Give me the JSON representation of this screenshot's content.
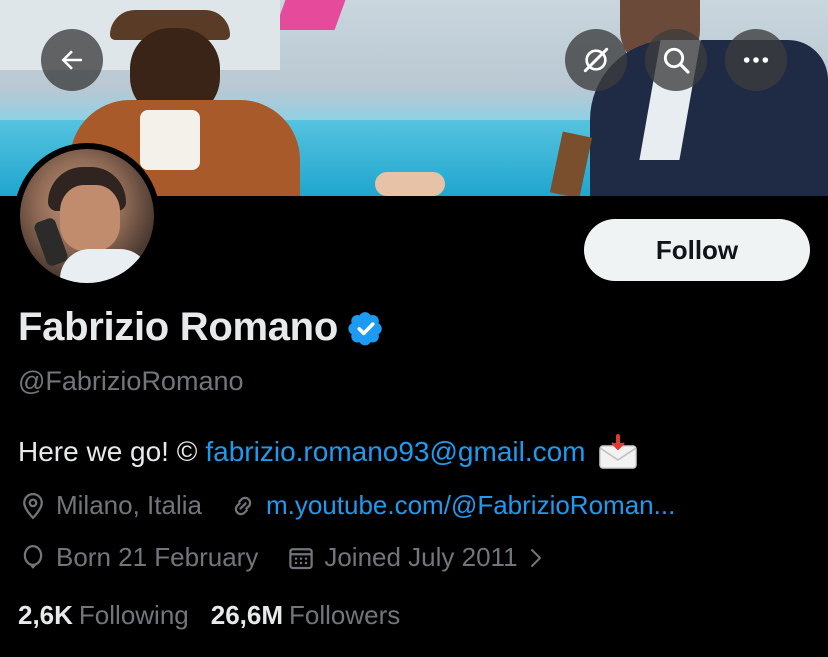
{
  "header": {
    "back_icon": "arrow-left-icon",
    "action_icons": [
      "disconnect-icon",
      "search-icon",
      "more-icon"
    ]
  },
  "profile": {
    "display_name": "Fabrizio Romano",
    "handle": "@FabrizioRomano",
    "follow_label": "Follow",
    "verified_color": "#1d9bf0"
  },
  "bio": {
    "text": "Here we go! ©",
    "email": "fabrizio.romano93@gmail.com",
    "emoji": "incoming-envelope-emoji"
  },
  "meta": {
    "location": "Milano, Italia",
    "website": "m.youtube.com/@FabrizioRoman...",
    "birthday": "Born 21 February",
    "joined": "Joined July 2011"
  },
  "stats": {
    "following_count": "2,6K",
    "following_label": "Following",
    "followers_count": "26,6M",
    "followers_label": "Followers"
  },
  "colors": {
    "background": "#000000",
    "primary_text": "#e7e9ea",
    "secondary_text": "#71767b",
    "link": "#1d9bf0",
    "follow_button_bg": "#eff3f4"
  }
}
